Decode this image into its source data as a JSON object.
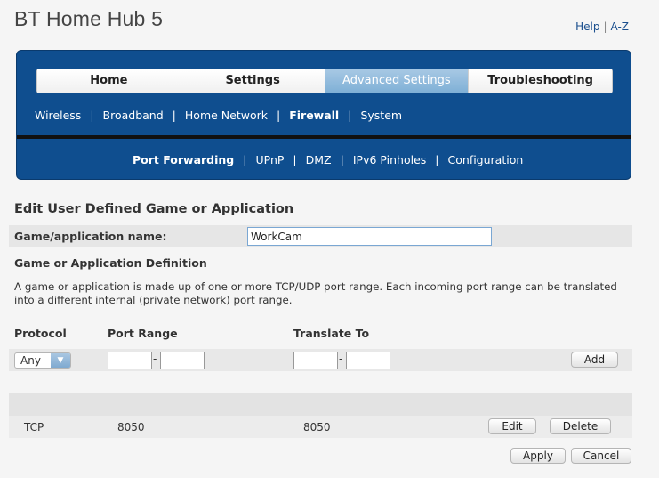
{
  "header": {
    "title": "BT Home Hub 5",
    "help_label": "Help",
    "az_label": "A-Z",
    "link_separator": "|"
  },
  "tabs": [
    {
      "label": "Home",
      "active": false
    },
    {
      "label": "Settings",
      "active": false
    },
    {
      "label": "Advanced Settings",
      "active": true
    },
    {
      "label": "Troubleshooting",
      "active": false
    }
  ],
  "subnav_primary": [
    {
      "label": "Wireless",
      "active": false
    },
    {
      "label": "Broadband",
      "active": false
    },
    {
      "label": "Home Network",
      "active": false
    },
    {
      "label": "Firewall",
      "active": true
    },
    {
      "label": "System",
      "active": false
    }
  ],
  "subnav_secondary": [
    {
      "label": "Port Forwarding",
      "active": true
    },
    {
      "label": "UPnP",
      "active": false
    },
    {
      "label": "DMZ",
      "active": false
    },
    {
      "label": "IPv6 Pinholes",
      "active": false
    },
    {
      "label": "Configuration",
      "active": false
    }
  ],
  "form": {
    "section_title": "Edit User Defined Game or Application",
    "name_label": "Game/application name:",
    "name_value": "WorkCam",
    "definition_title": "Game or Application Definition",
    "description_line1": "A game or application is made up of one or more TCP/UDP port range. Each incoming port range can be translated",
    "description_line2": "into a different internal (private network) port range.",
    "headers": {
      "protocol": "Protocol",
      "port_range": "Port Range",
      "translate_to": "Translate To"
    },
    "protocol_selected": "Any",
    "range_separator": "-",
    "add_label": "Add"
  },
  "rules": [
    {
      "protocol": "TCP",
      "port_range": "8050",
      "translate_to": "8050",
      "edit_label": "Edit",
      "delete_label": "Delete"
    }
  ],
  "actions": {
    "apply_label": "Apply",
    "cancel_label": "Cancel"
  },
  "colors": {
    "nav_blue": "#0f4e8f",
    "active_tab": "#8fbadc",
    "link_blue": "#1b4f8e"
  }
}
